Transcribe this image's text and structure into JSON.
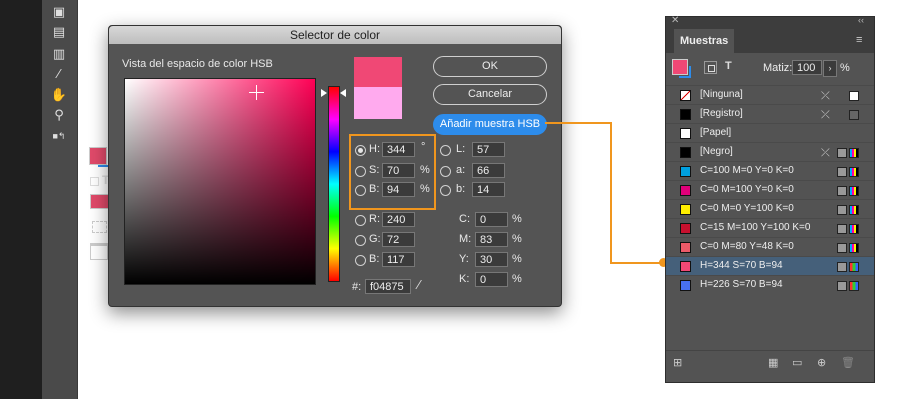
{
  "dialog": {
    "title": "Selector de color",
    "space_label": "Vista del espacio de color HSB",
    "ok_label": "OK",
    "cancel_label": "Cancelar",
    "add_label": "Añadir muestra HSB",
    "new_color": "#f04875",
    "old_color": "#ffaaee",
    "hsb": {
      "h_label": "H:",
      "h": "344",
      "h_unit": "°",
      "s_label": "S:",
      "s": "70",
      "s_unit": "%",
      "b_label": "B:",
      "b": "94",
      "b_unit": "%"
    },
    "lab": {
      "l_label": "L:",
      "l": "57",
      "a_label": "a:",
      "a": "66",
      "b_label": "b:",
      "b": "14"
    },
    "rgb": {
      "r_label": "R:",
      "r": "240",
      "g_label": "G:",
      "g": "72",
      "b_label": "B:",
      "b": "117"
    },
    "cmyk": {
      "c_label": "C:",
      "c": "0",
      "m_label": "M:",
      "m": "83",
      "y_label": "Y:",
      "y": "30",
      "k_label": "K:",
      "k": "0",
      "unit": "%"
    },
    "hex_label": "#:",
    "hex": "f04875"
  },
  "panel": {
    "tab_label": "Muestras",
    "tint_label": "Matiz:",
    "tint_value": "100",
    "tint_unit": "%",
    "swatches": [
      {
        "name": "[Ninguna]",
        "color": "none"
      },
      {
        "name": "[Registro]",
        "color": "#000000"
      },
      {
        "name": "[Papel]",
        "color": "#ffffff"
      },
      {
        "name": "[Negro]",
        "color": "#000000"
      },
      {
        "name": "C=100 M=0 Y=0 K=0",
        "color": "#00a0e0"
      },
      {
        "name": "C=0 M=100 Y=0 K=0",
        "color": "#e0007a"
      },
      {
        "name": "C=0 M=0 Y=100 K=0",
        "color": "#ffee00"
      },
      {
        "name": "C=15 M=100 Y=100 K=0",
        "color": "#c8102e"
      },
      {
        "name": "C=0 M=80 Y=48 K=0",
        "color": "#ec5a68"
      },
      {
        "name": "H=344 S=70 B=94",
        "color": "#f04875"
      },
      {
        "name": "H=226 S=70 B=94",
        "color": "#4870f0"
      }
    ]
  },
  "colors": {
    "accent": "#f0961e",
    "active_button": "#2d8ceb",
    "fill": "#e04a6a"
  }
}
